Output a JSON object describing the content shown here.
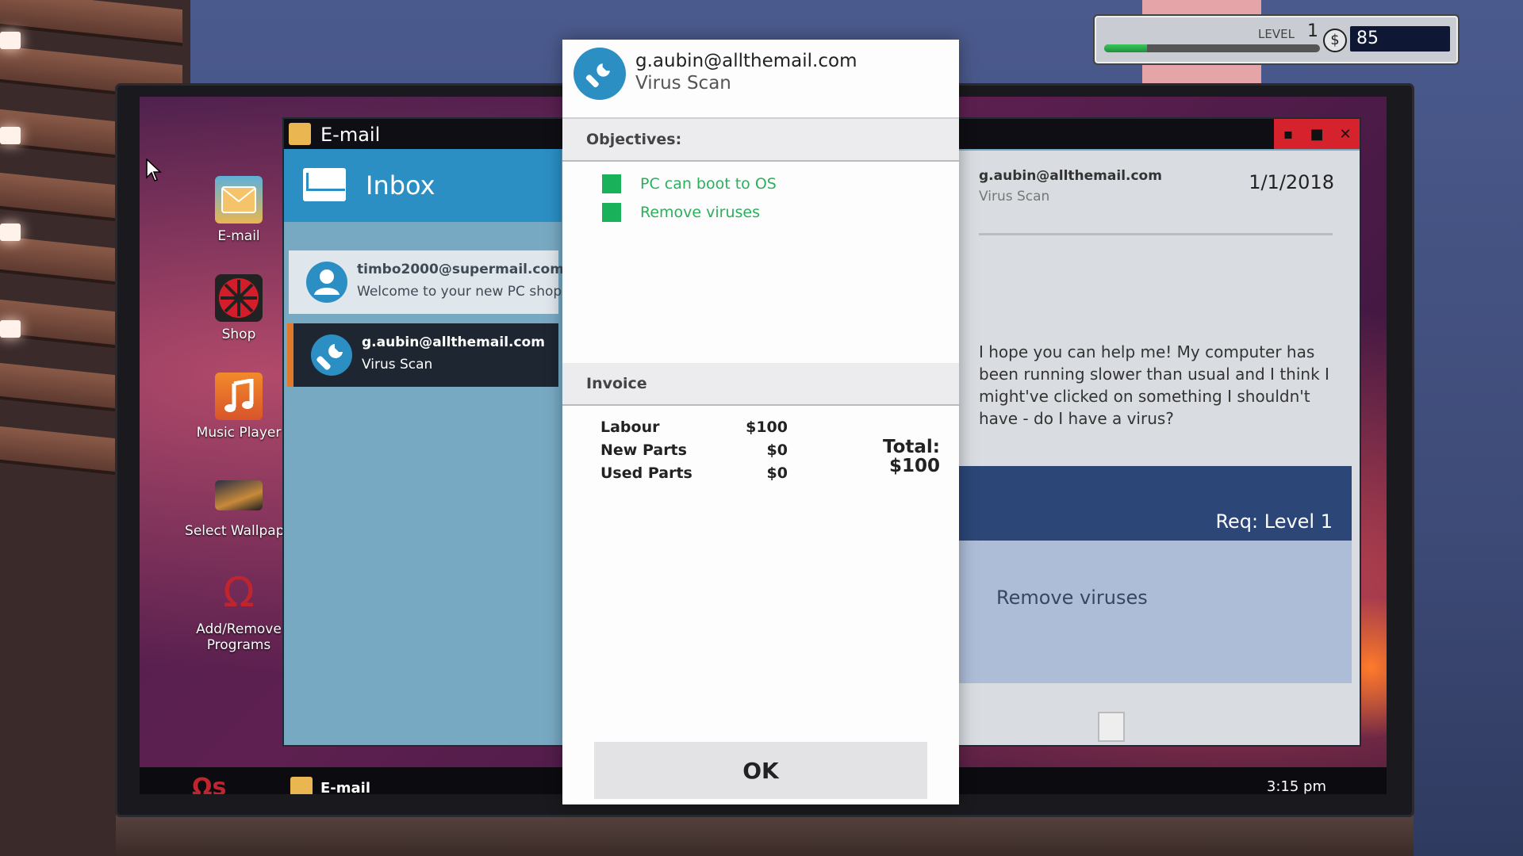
{
  "hud": {
    "level_label": "LEVEL",
    "level": "1",
    "currency_symbol": "$",
    "money": "85",
    "xp_progress": 0.2
  },
  "desktop_icons": [
    {
      "label": "E-mail"
    },
    {
      "label": "Shop"
    },
    {
      "label": "Music Player"
    },
    {
      "label": "Select Wallpape"
    },
    {
      "label": "Add/Remove Programs"
    }
  ],
  "email_window": {
    "title": "E-mail",
    "controls": {
      "minimize": "▪",
      "maximize": "■",
      "close": "✕"
    },
    "inbox_title": "Inbox",
    "messages": [
      {
        "from": "timbo2000@supermail.com",
        "subject": "Welcome to your new PC shop"
      },
      {
        "from": "g.aubin@allthemail.com",
        "subject": "Virus Scan"
      }
    ],
    "reading": {
      "from": "g.aubin@allthemail.com",
      "subject": "Virus Scan",
      "date": "1/1/2018",
      "body": "I hope you can help me! My computer has been running slower than usual and I think I might've clicked on something I shouldn't have - do I have a virus?",
      "req": "Req: Level 1",
      "objective": "Remove viruses"
    }
  },
  "taskbar": {
    "start_label": "Ωs",
    "task_label": "E-mail",
    "clock": "3:15 pm"
  },
  "modal": {
    "from": "g.aubin@allthemail.com",
    "subject": "Virus Scan",
    "objectives_title": "Objectives:",
    "objectives": [
      "PC can boot to OS",
      "Remove viruses"
    ],
    "invoice_title": "Invoice",
    "invoice": [
      {
        "label": "Labour",
        "value": "$100"
      },
      {
        "label": "New Parts",
        "value": "$0"
      },
      {
        "label": "Used Parts",
        "value": "$0"
      }
    ],
    "total_label": "Total:",
    "total_value": "$100",
    "ok_label": "OK"
  },
  "colors": {
    "objective_green": "#19b15a",
    "accent_blue": "#2b8fc4",
    "close_red": "#d6222d"
  }
}
